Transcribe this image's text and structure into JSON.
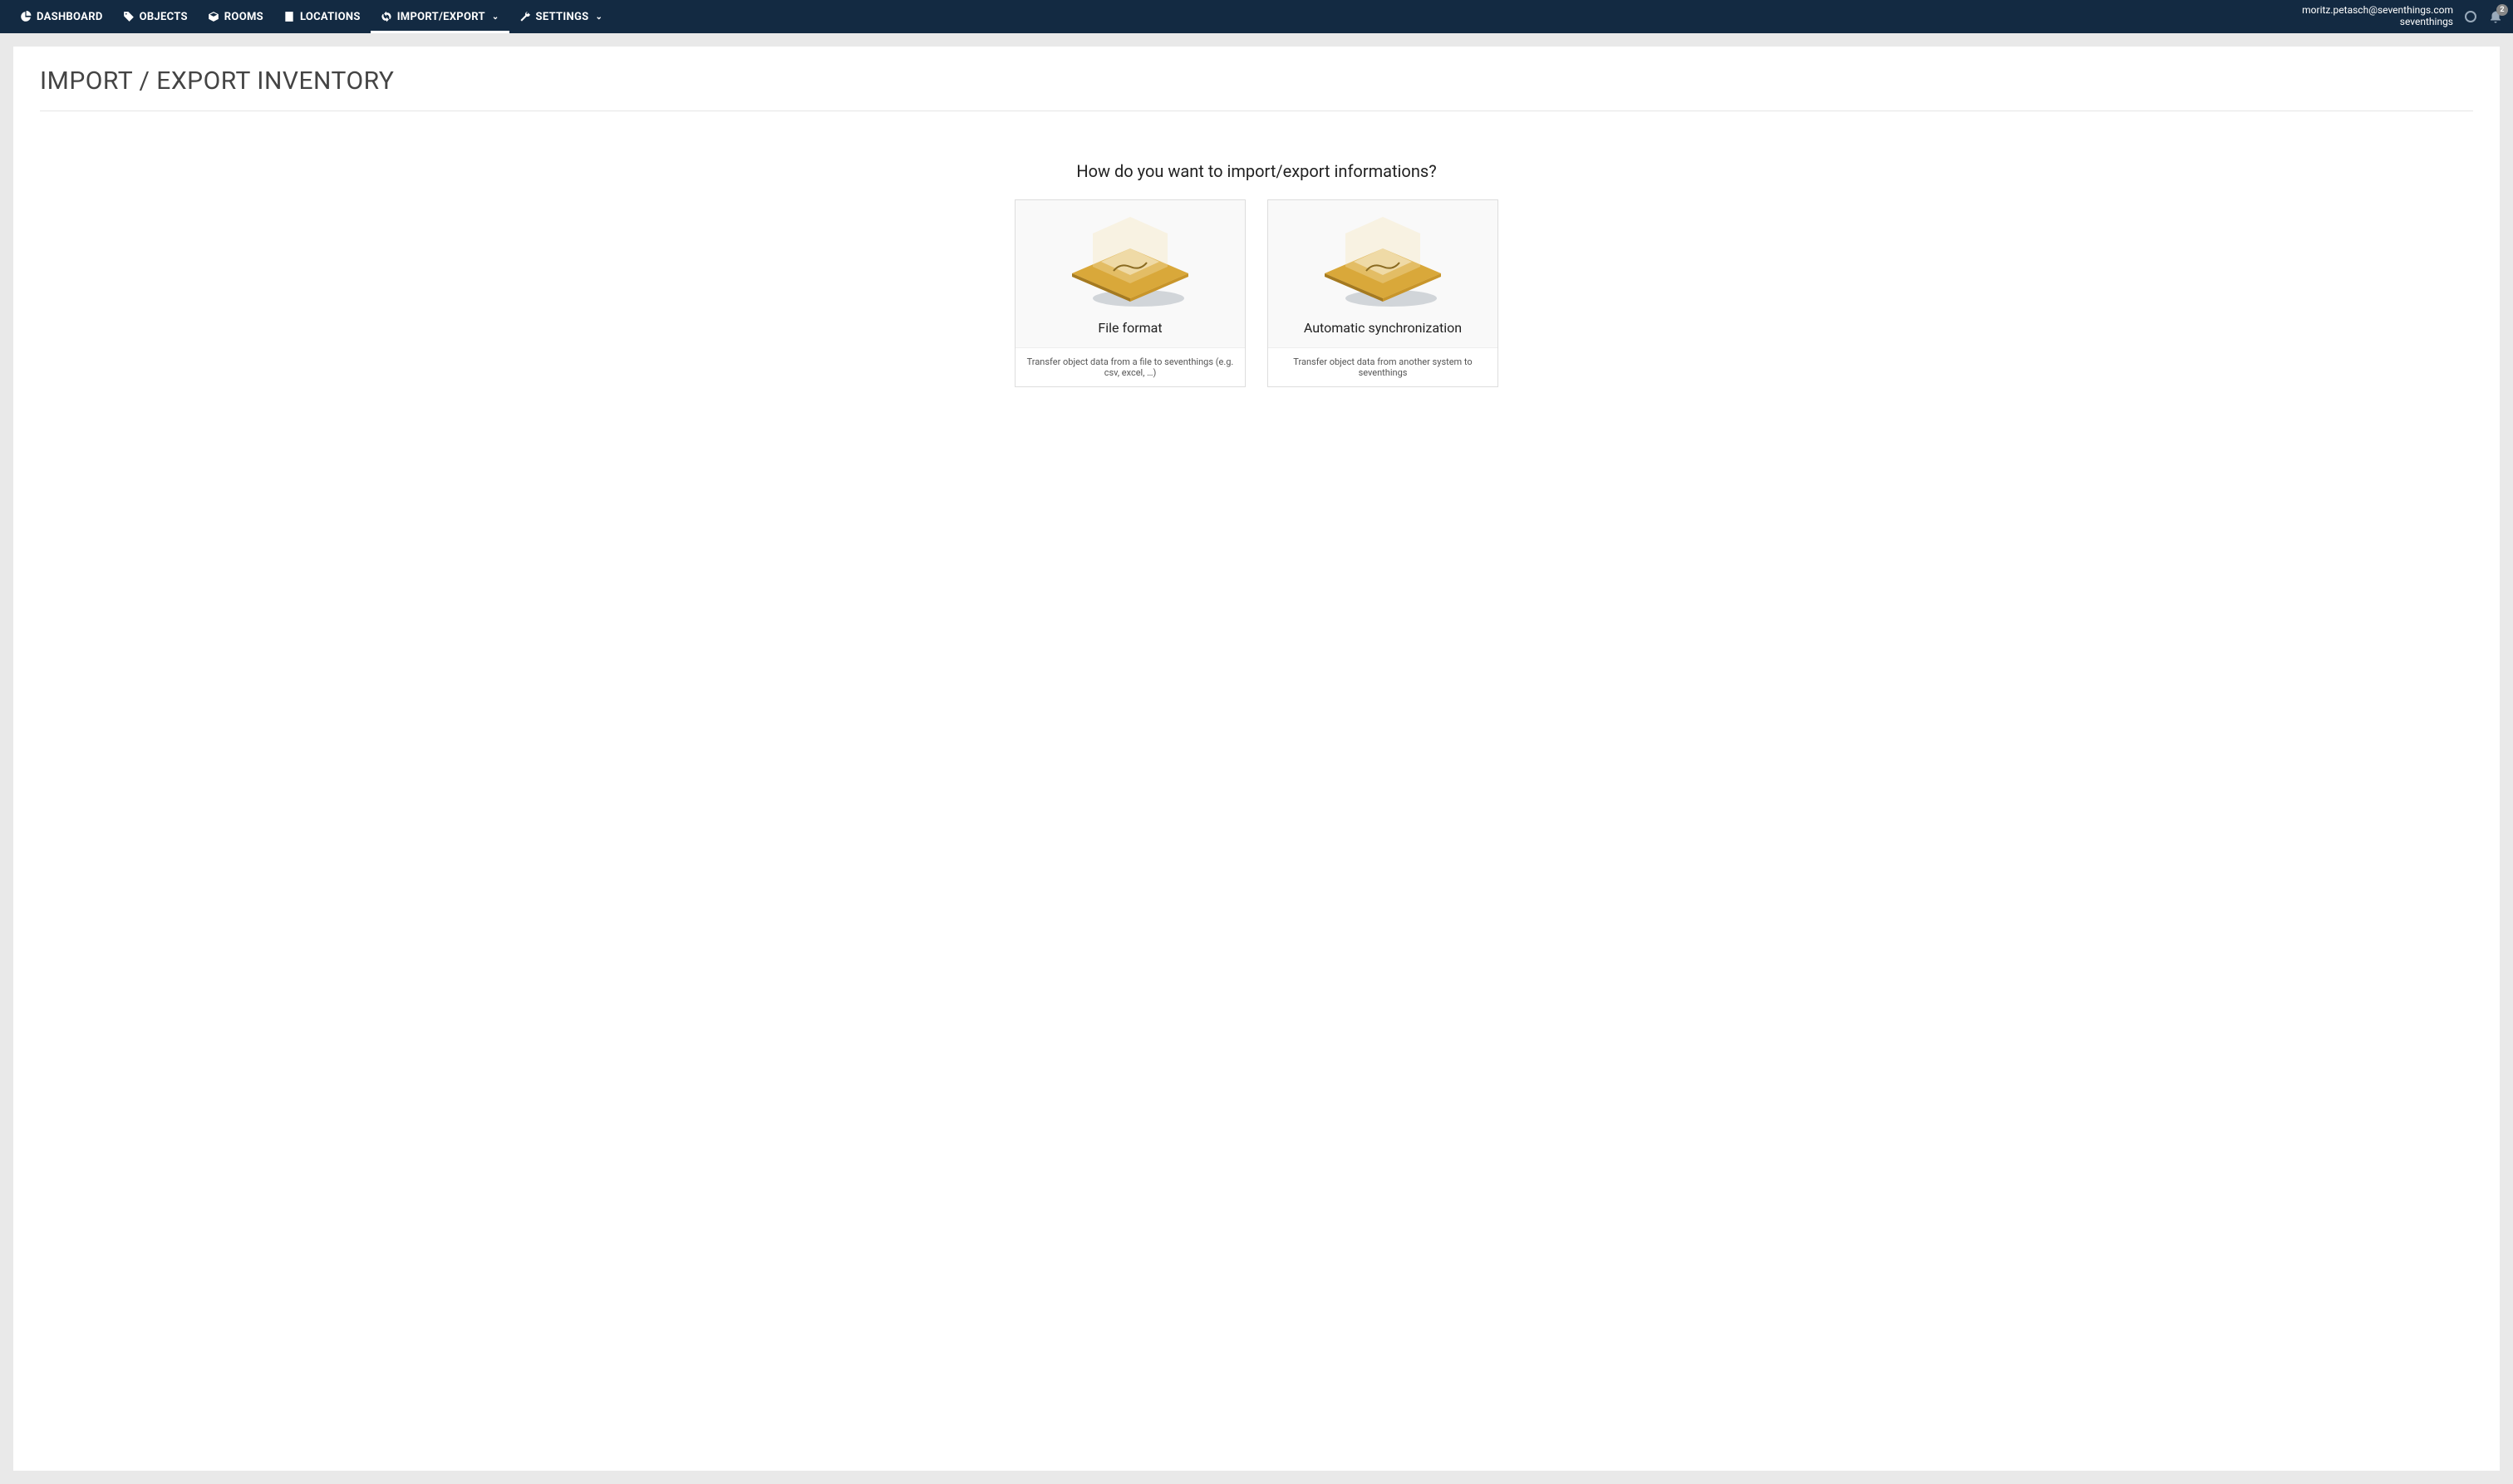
{
  "nav": {
    "items": [
      {
        "label": "DASHBOARD"
      },
      {
        "label": "OBJECTS"
      },
      {
        "label": "ROOMS"
      },
      {
        "label": "LOCATIONS"
      },
      {
        "label": "IMPORT/EXPORT"
      },
      {
        "label": "SETTINGS"
      }
    ]
  },
  "user": {
    "email": "moritz.petasch@seventhings.com",
    "org": "seventhings",
    "notification_count": "2"
  },
  "page": {
    "title": "IMPORT / EXPORT INVENTORY",
    "question": "How do you want to import/export informations?",
    "cards": [
      {
        "title": "File format",
        "description": "Transfer object data from a file to seventhings (e.g. csv, excel, …)"
      },
      {
        "title": "Automatic synchronization",
        "description": "Transfer object data from another system to seventhings"
      }
    ]
  }
}
